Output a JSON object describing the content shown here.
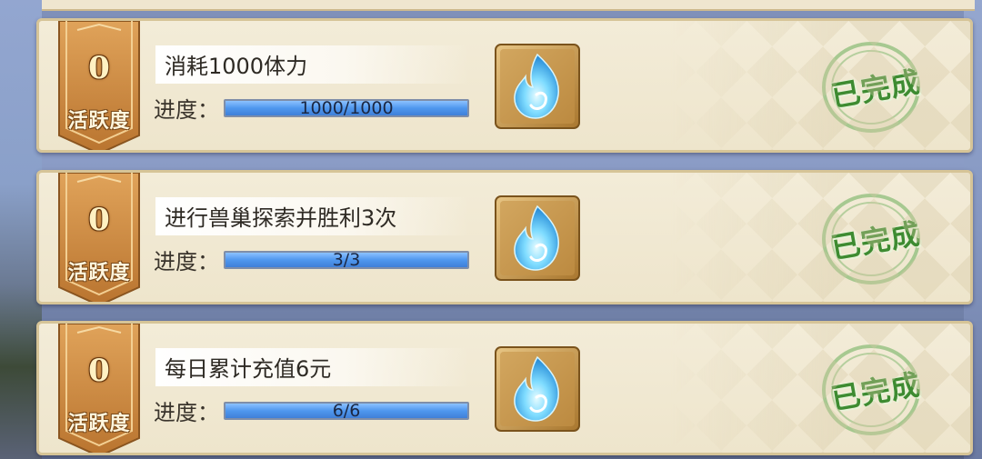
{
  "tasks": [
    {
      "points": "0",
      "points_label": "活跃度",
      "title": "消耗1000体力",
      "progress_label": "进度：",
      "progress_text": "1000/1000",
      "progress_fraction": 1.0,
      "reward_icon": "blue-flame-icon",
      "status": "已完成"
    },
    {
      "points": "0",
      "points_label": "活跃度",
      "title": "进行兽巢探索并胜利3次",
      "progress_label": "进度：",
      "progress_text": "3/3",
      "progress_fraction": 1.0,
      "reward_icon": "blue-flame-icon",
      "status": "已完成"
    },
    {
      "points": "0",
      "points_label": "活跃度",
      "title": "每日累计充值6元",
      "progress_label": "进度：",
      "progress_text": "6/6",
      "progress_fraction": 1.0,
      "reward_icon": "blue-flame-icon",
      "status": "已完成"
    }
  ],
  "colors": {
    "badge_brown": "#c98a45",
    "progress_fill": "#4f97ee",
    "stamp_green": "#3e8b31"
  }
}
